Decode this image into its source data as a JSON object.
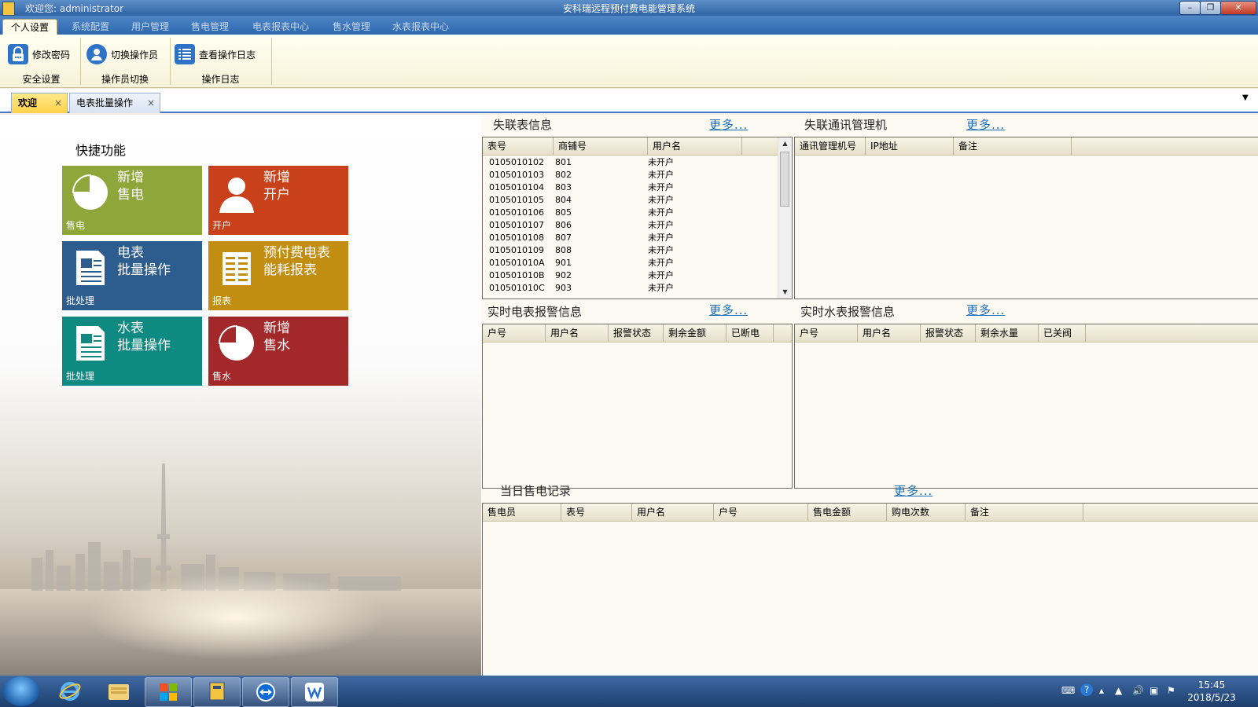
{
  "titlebar": {
    "welcome": "欢迎您: administrator",
    "title": "安科瑞远程预付费电能管理系统",
    "buttons": {
      "minimize": "–",
      "restore": "❐",
      "close": "✕"
    }
  },
  "menu": {
    "tabs": [
      {
        "label": "个人设置",
        "active": true
      },
      {
        "label": "系统配置"
      },
      {
        "label": "用户管理"
      },
      {
        "label": "售电管理"
      },
      {
        "label": "电表报表中心"
      },
      {
        "label": "售水管理"
      },
      {
        "label": "水表报表中心"
      }
    ]
  },
  "ribbon": {
    "buttons": [
      {
        "label": "修改密码",
        "icon": "lock-icon"
      },
      {
        "label": "切换操作员",
        "icon": "user-switch-icon"
      },
      {
        "label": "查看操作日志",
        "icon": "list-icon"
      }
    ],
    "groups": [
      "安全设置",
      "操作员切换",
      "操作日志"
    ]
  },
  "doctabs": {
    "tabs": [
      {
        "label": "欢迎",
        "active": true
      },
      {
        "label": "电表批量操作"
      }
    ],
    "close": "×",
    "dropdown": "▼"
  },
  "quick": {
    "title": "快捷功能",
    "tiles": [
      {
        "line1": "新增",
        "line2": "售电",
        "caption": "售电",
        "color": "#8ea63a",
        "icon": "pie-icon"
      },
      {
        "line1": "新增",
        "line2": "开户",
        "caption": "开户",
        "color": "#c8411a",
        "icon": "user-icon"
      },
      {
        "line1": "电表",
        "line2": "批量操作",
        "caption": "批处理",
        "color": "#2c5d8e",
        "icon": "document-icon"
      },
      {
        "line1": "预付费电表",
        "line2": "能耗报表",
        "caption": "报表",
        "color": "#c28e12",
        "icon": "report-icon"
      },
      {
        "line1": "水表",
        "line2": "批量操作",
        "caption": "批处理",
        "color": "#0f8a82",
        "icon": "document-icon"
      },
      {
        "line1": "新增",
        "line2": "售水",
        "caption": "售水",
        "color": "#a3282a",
        "icon": "pie-icon"
      }
    ]
  },
  "lost_meters": {
    "title": "失联表信息",
    "more": "更多...",
    "columns": [
      "表号",
      "商铺号",
      "用户名"
    ],
    "rows": [
      [
        "0105010102",
        "801",
        "未开户"
      ],
      [
        "0105010103",
        "802",
        "未开户"
      ],
      [
        "0105010104",
        "803",
        "未开户"
      ],
      [
        "0105010105",
        "804",
        "未开户"
      ],
      [
        "0105010106",
        "805",
        "未开户"
      ],
      [
        "0105010107",
        "806",
        "未开户"
      ],
      [
        "0105010108",
        "807",
        "未开户"
      ],
      [
        "0105010109",
        "808",
        "未开户"
      ],
      [
        "010501010A",
        "901",
        "未开户"
      ],
      [
        "010501010B",
        "902",
        "未开户"
      ],
      [
        "010501010C",
        "903",
        "未开户"
      ]
    ]
  },
  "lost_managers": {
    "title": "失联通讯管理机",
    "more": "更多...",
    "columns": [
      "通讯管理机号",
      "IP地址",
      "备注"
    ]
  },
  "elec_alarms": {
    "title": "实时电表报警信息",
    "more": "更多...",
    "columns": [
      "户号",
      "用户名",
      "报警状态",
      "剩余金额",
      "已断电"
    ]
  },
  "water_alarms": {
    "title": "实时水表报警信息",
    "more": "更多...",
    "columns": [
      "户号",
      "用户名",
      "报警状态",
      "剩余水量",
      "已关阀"
    ]
  },
  "sales": {
    "title": "当日售电记录",
    "more": "更多...",
    "columns": [
      "售电员",
      "表号",
      "用户名",
      "户号",
      "售电金额",
      "购电次数",
      "备注"
    ]
  },
  "taskbar": {
    "apps": [
      "start-orb-icon",
      "ie-icon",
      "explorer-icon",
      "windows-flag-icon",
      "app-icon",
      "teamviewer-icon",
      "wps-icon"
    ],
    "clock": {
      "time": "15:45",
      "date": "2018/5/23"
    }
  }
}
